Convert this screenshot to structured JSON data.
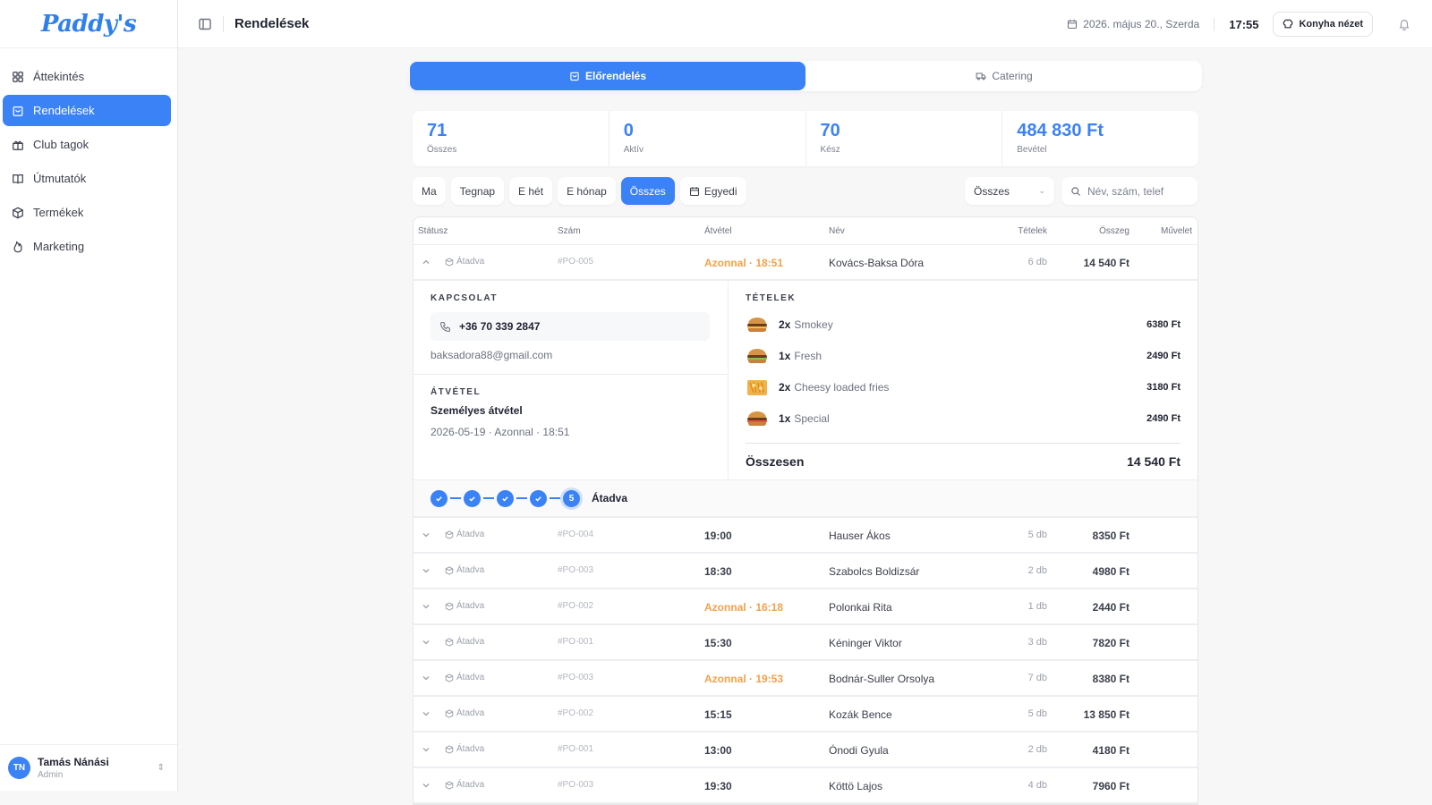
{
  "app": {
    "logo": "Paddy's"
  },
  "sidebar": {
    "items": [
      {
        "label": "Áttekintés",
        "icon": "grid-icon",
        "active": false
      },
      {
        "label": "Rendelések",
        "icon": "bag-icon",
        "active": true
      },
      {
        "label": "Club tagok",
        "icon": "gift-icon",
        "active": false
      },
      {
        "label": "Útmutatók",
        "icon": "book-icon",
        "active": false
      },
      {
        "label": "Termékek",
        "icon": "box-icon",
        "active": false
      },
      {
        "label": "Marketing",
        "icon": "flame-icon",
        "active": false
      }
    ],
    "user": {
      "initials": "TN",
      "name": "Tamás Nánási",
      "role": "Admin"
    }
  },
  "header": {
    "title": "Rendelések",
    "date": "2026. május 20., Szerda",
    "time": "17:55",
    "kitchen_label": "Konyha nézet"
  },
  "tabs": [
    {
      "label": "Előrendelés",
      "active": true
    },
    {
      "label": "Catering",
      "active": false
    }
  ],
  "stats": [
    {
      "value": "71",
      "label": "Összes"
    },
    {
      "value": "0",
      "label": "Aktív"
    },
    {
      "value": "70",
      "label": "Kész"
    },
    {
      "value": "484 830 Ft",
      "label": "Bevétel"
    }
  ],
  "filters": {
    "buttons": [
      "Ma",
      "Tegnap",
      "E hét",
      "E hónap",
      "Összes",
      "Egyedi"
    ],
    "active": "Összes",
    "select_value": "Összes",
    "search_placeholder": "Név, szám, telef"
  },
  "table": {
    "headers": {
      "status": "Státusz",
      "number": "Szám",
      "pickup": "Átvétel",
      "name": "Név",
      "items": "Tételek",
      "total": "Összeg",
      "action": "Művelet"
    },
    "expanded_row": {
      "status": "Átadva",
      "number": "#PO-005",
      "pickup": "Azonnal · 18:51",
      "name": "Kovács-Baksa Dóra",
      "items": "6 db",
      "total": "14 540 Ft",
      "contact_head": "KAPCSOLAT",
      "phone": "+36 70 339 2847",
      "email": "baksadora88@gmail.com",
      "pickup_head": "ÁTVÉTEL",
      "pickup_type": "Személyes átvétel",
      "pickup_when": "2026-05-19 · Azonnal · 18:51",
      "items_head": "TÉTELEK",
      "line_items": [
        {
          "qty": "2x",
          "name": "Smokey",
          "price": "6380 Ft",
          "icon": "burger-icon"
        },
        {
          "qty": "1x",
          "name": "Fresh",
          "price": "2490 Ft",
          "icon": "burger-icon"
        },
        {
          "qty": "2x",
          "name": "Cheesy loaded fries",
          "price": "3180 Ft",
          "icon": "fries-icon"
        },
        {
          "qty": "1x",
          "name": "Special",
          "price": "2490 Ft",
          "icon": "burger-icon"
        }
      ],
      "total_label": "Összesen",
      "total_value": "14 540 Ft",
      "progress_step": "5",
      "progress_label": "Átadva"
    },
    "rows": [
      {
        "status": "Átadva",
        "number": "#PO-004",
        "pickup": "19:00",
        "urgent": false,
        "name": "Hauser Ákos",
        "items": "5 db",
        "total": "8350 Ft"
      },
      {
        "status": "Átadva",
        "number": "#PO-003",
        "pickup": "18:30",
        "urgent": false,
        "name": "Szabolcs Boldizsár",
        "items": "2 db",
        "total": "4980 Ft"
      },
      {
        "status": "Átadva",
        "number": "#PO-002",
        "pickup": "Azonnal · 16:18",
        "urgent": true,
        "name": "Polonkai Rita",
        "items": "1 db",
        "total": "2440 Ft"
      },
      {
        "status": "Átadva",
        "number": "#PO-001",
        "pickup": "15:30",
        "urgent": false,
        "name": "Kéninger Viktor",
        "items": "3 db",
        "total": "7820 Ft"
      },
      {
        "status": "Átadva",
        "number": "#PO-003",
        "pickup": "Azonnal · 19:53",
        "urgent": true,
        "name": "Bodnár-Suller Orsolya",
        "items": "7 db",
        "total": "8380 Ft"
      },
      {
        "status": "Átadva",
        "number": "#PO-002",
        "pickup": "15:15",
        "urgent": false,
        "name": "Kozák Bence",
        "items": "5 db",
        "total": "13 850 Ft"
      },
      {
        "status": "Átadva",
        "number": "#PO-001",
        "pickup": "13:00",
        "urgent": false,
        "name": "Ónodi Gyula",
        "items": "2 db",
        "total": "4180 Ft"
      },
      {
        "status": "Átadva",
        "number": "#PO-003",
        "pickup": "19:30",
        "urgent": false,
        "name": "Köttö Lajos",
        "items": "4 db",
        "total": "7960 Ft"
      }
    ]
  },
  "colors": {
    "accent": "#3b82f6",
    "urgent": "#f5a04a"
  }
}
